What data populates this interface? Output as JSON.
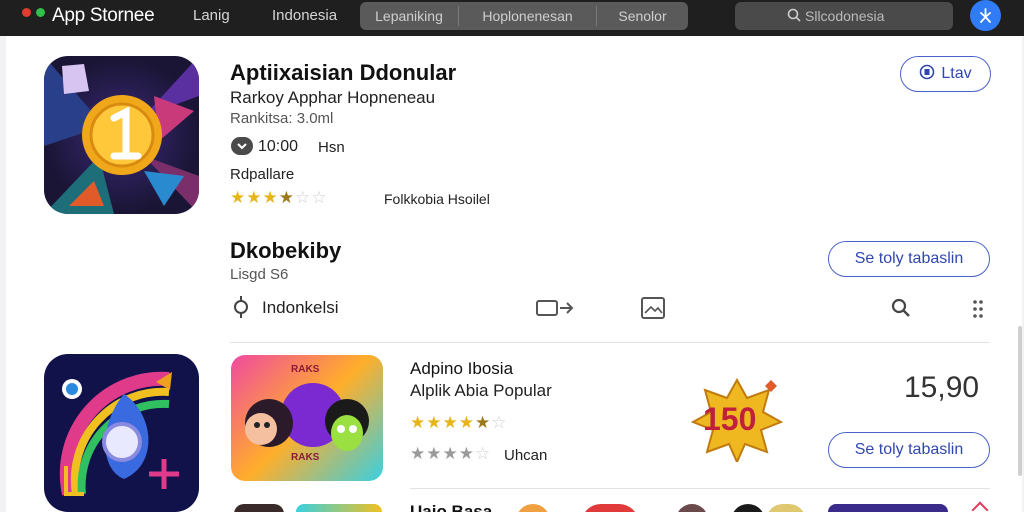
{
  "topbar": {
    "brand": "App Stornee",
    "links": [
      "Lanig",
      "Indonesia"
    ],
    "segments": [
      "Lepaniking",
      "Hoplonenesan",
      "Senolor"
    ],
    "search_placeholder": "Sllcodonesia"
  },
  "featured": {
    "title": "Aptiixaisian Ddonular",
    "subtitle": "Rarkoy Apphar Hopneneau",
    "ranking": "Rankitsa: 3.0ml",
    "time": "10:00",
    "time_unit": "Hsn",
    "category": "Rdpallare",
    "rating": 3.5,
    "rating_label": "Folkkobia Hsoilel",
    "action_label": "Ltav"
  },
  "section": {
    "title": "Dkobekiby",
    "subtitle": "Lisgd S6",
    "location": "Indonkelsi",
    "action_label": "Se toly tabaslin"
  },
  "list_item": {
    "title": "Adpino Ibosia",
    "subtitle": "Alplik Abia Popular",
    "rating": 4.5,
    "sub_label": "Uhcan",
    "badge": "150",
    "price": "15,90",
    "action_label": "Se toly tabaslin",
    "game_art_top": "RAKS",
    "game_art_bottom": "RAKS"
  },
  "bottom_partial": {
    "title": "Uaio Basa"
  },
  "colors": {
    "accent": "#2f7cf6",
    "outline": "#4a63c8",
    "star": "#e7b51a"
  }
}
